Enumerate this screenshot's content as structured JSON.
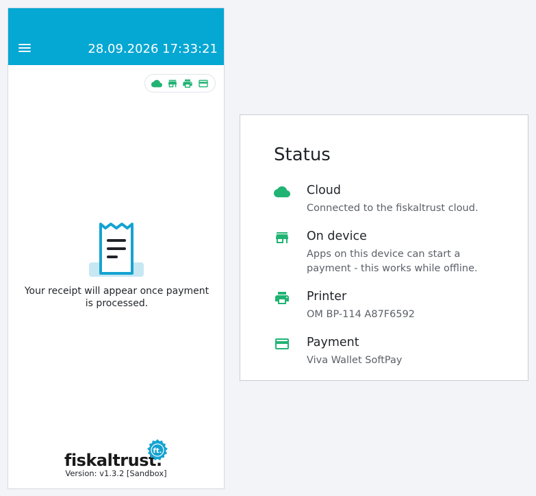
{
  "header": {
    "datetime": "28.09.2026 17:33:21",
    "color": "#05a7d3"
  },
  "status_pill": {
    "icons": [
      "cloud-icon",
      "store-icon",
      "printer-icon",
      "credit-card-icon"
    ],
    "icon_color": "#21b373"
  },
  "receipt": {
    "message": "Your receipt will appear once payment is processed."
  },
  "footer": {
    "logo_text": "fiskaltrust.",
    "logo_seal_text": "ft.",
    "version": "Version: v1.3.2 [Sandbox]"
  },
  "status_card": {
    "title": "Status",
    "items": [
      {
        "icon": "cloud-icon",
        "title": "Cloud",
        "description": "Connected to the fiskaltrust cloud."
      },
      {
        "icon": "store-icon",
        "title": "On device",
        "description": "Apps on this device can start a payment - this works while offline."
      },
      {
        "icon": "printer-icon",
        "title": "Printer",
        "description": "OM BP-114 A87F6592"
      },
      {
        "icon": "credit-card-icon",
        "title": "Payment",
        "description": "Viva Wallet SoftPay"
      }
    ],
    "accent_color": "#21b373"
  }
}
